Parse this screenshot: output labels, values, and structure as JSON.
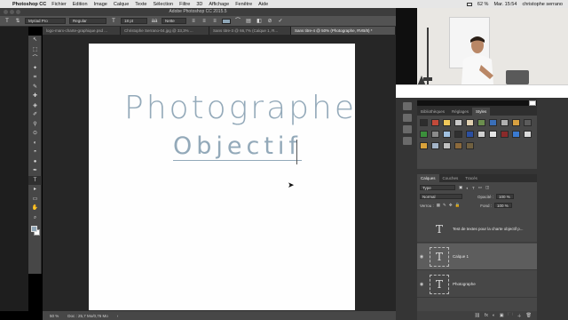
{
  "menubar": {
    "apple": "",
    "app": "Photoshop CC",
    "items": [
      "Fichier",
      "Edition",
      "Image",
      "Calque",
      "Texte",
      "Sélection",
      "Filtre",
      "3D",
      "Affichage",
      "Fenêtre",
      "Aide"
    ],
    "battery": "62 %",
    "clock": "Mar. 15:54",
    "user": "christophe serrano"
  },
  "titlebar": {
    "title": "Adobe Photoshop CC 2015.5"
  },
  "options": {
    "tool_icon": "T",
    "font_family": "Myriad Pro",
    "font_style": "Regular",
    "font_size": "18 pt",
    "antialias_label": "aa",
    "antialias": "Nette",
    "cancel_icon": "⊘",
    "commit_icon": "✓",
    "text_color": "#8fa6b7"
  },
  "tabs": [
    "logo-marx-charte-graphique.psd ...",
    "Christophe Serrano-04.jpg @ 33,3% ...",
    "Sans titre-3 @ 66,7% (Calque 1, R...",
    "Sans titre-4 @ 50% (Photographe, RVB/8) *"
  ],
  "toolbar": {
    "tools": [
      "↖",
      "⬚",
      "⌒",
      "✦",
      "⌗",
      "✎",
      "✚",
      "◈",
      "✐",
      "⚲",
      "⊙",
      "◐",
      "◓",
      "●",
      "✒",
      "T",
      "▸",
      "▭",
      "✋",
      "⌕"
    ],
    "foreground_color": "#8fa6b7",
    "background_color": "#ffffff"
  },
  "canvas": {
    "headline": "Photographe",
    "subline": "Objectif"
  },
  "status": {
    "zoom": "50 %",
    "doc": "Doc : 25,7 Mo/0,76 Mo",
    "arrow": "›"
  },
  "panels": {
    "top_tabs": [
      "Bibliothèques",
      "Réglages",
      "Styles"
    ],
    "active_top_tab": "Styles",
    "style_swatches": [
      "#2d2d2d",
      "#c24a3a",
      "#f0c85a",
      "#c8c8c8",
      "#e0d0b0",
      "#6b8e4e",
      "#3a6fb8",
      "#b0b0b0",
      "#d8a040",
      "#5c5c5c",
      "#3b8f3b",
      "#8b8b8b",
      "#a0c0e0",
      "#303030",
      "#2b4fa0",
      "#d0d0d0",
      "#e6e6e6",
      "#8a2a2a",
      "#3a7ad0",
      "#dadada",
      "#d9a23a",
      "#a3b4c8",
      "#c0c0c0",
      "#8c6a3c",
      "#706040"
    ],
    "layer_tabs": [
      "Calques",
      "Couches",
      "Tracés"
    ],
    "active_layer_tab": "Calques",
    "kind_label": "Type",
    "blend_mode": "Normal",
    "opacity_label": "Opacité :",
    "opacity": "100 %",
    "lock_label": "Verrou :",
    "fill_label": "Fond :",
    "fill": "100 %",
    "layers": [
      {
        "name": "Test de textes pour la charte objectif p...",
        "thumb": "T",
        "visible": false,
        "selected": false
      },
      {
        "name": "Calque 1",
        "thumb": "T",
        "visible": true,
        "selected": true
      },
      {
        "name": "Photographe",
        "thumb": "T",
        "visible": true,
        "selected": false
      }
    ],
    "footer_icons": [
      "fx",
      "◐",
      "▣",
      "🗀",
      "＋",
      "🗑"
    ]
  }
}
